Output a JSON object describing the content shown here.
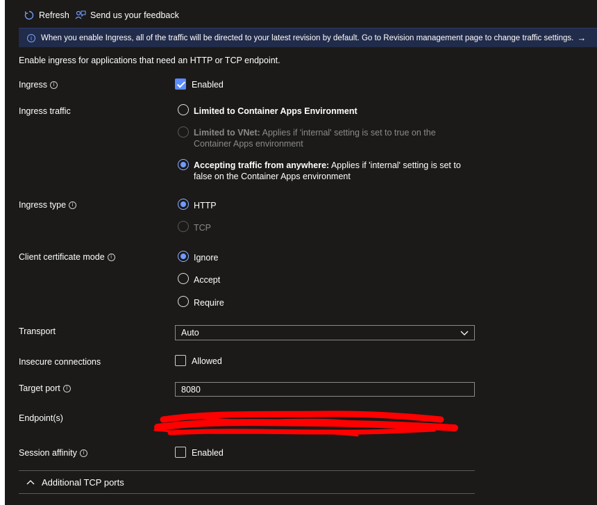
{
  "toolbar": {
    "refresh_label": "Refresh",
    "feedback_label": "Send us your feedback"
  },
  "banner": {
    "text": "When you enable Ingress, all of the traffic will be directed to your latest revision by default. Go to Revision management page to change traffic settings."
  },
  "intro": "Enable ingress for applications that need an HTTP or TCP endpoint.",
  "ingress": {
    "label": "Ingress",
    "checkbox_label": "Enabled",
    "checked": true
  },
  "ingress_traffic": {
    "label": "Ingress traffic",
    "options": [
      {
        "title": "Limited to Container Apps Environment",
        "desc": ""
      },
      {
        "title": "Limited to VNet:",
        "desc": " Applies if 'internal' setting is set to true on the Container Apps environment"
      },
      {
        "title": "Accepting traffic from anywhere:",
        "desc": " Applies if 'internal' setting is set to false on the Container Apps environment"
      }
    ]
  },
  "ingress_type": {
    "label": "Ingress type",
    "options": [
      "HTTP",
      "TCP"
    ]
  },
  "client_cert": {
    "label": "Client certificate mode",
    "options": [
      "Ignore",
      "Accept",
      "Require"
    ]
  },
  "transport": {
    "label": "Transport",
    "value": "Auto"
  },
  "insecure": {
    "label": "Insecure connections",
    "checkbox_label": "Allowed"
  },
  "target_port": {
    "label": "Target port",
    "value": "8080"
  },
  "endpoints": {
    "label": "Endpoint(s)"
  },
  "session_affinity": {
    "label": "Session affinity",
    "checkbox_label": "Enabled"
  },
  "additional_tcp": {
    "label": "Additional TCP ports"
  },
  "colors": {
    "accent": "#5b8cff",
    "banner_bg": "#212b4a",
    "background": "#1b1a19",
    "redaction": "#ff0000"
  }
}
